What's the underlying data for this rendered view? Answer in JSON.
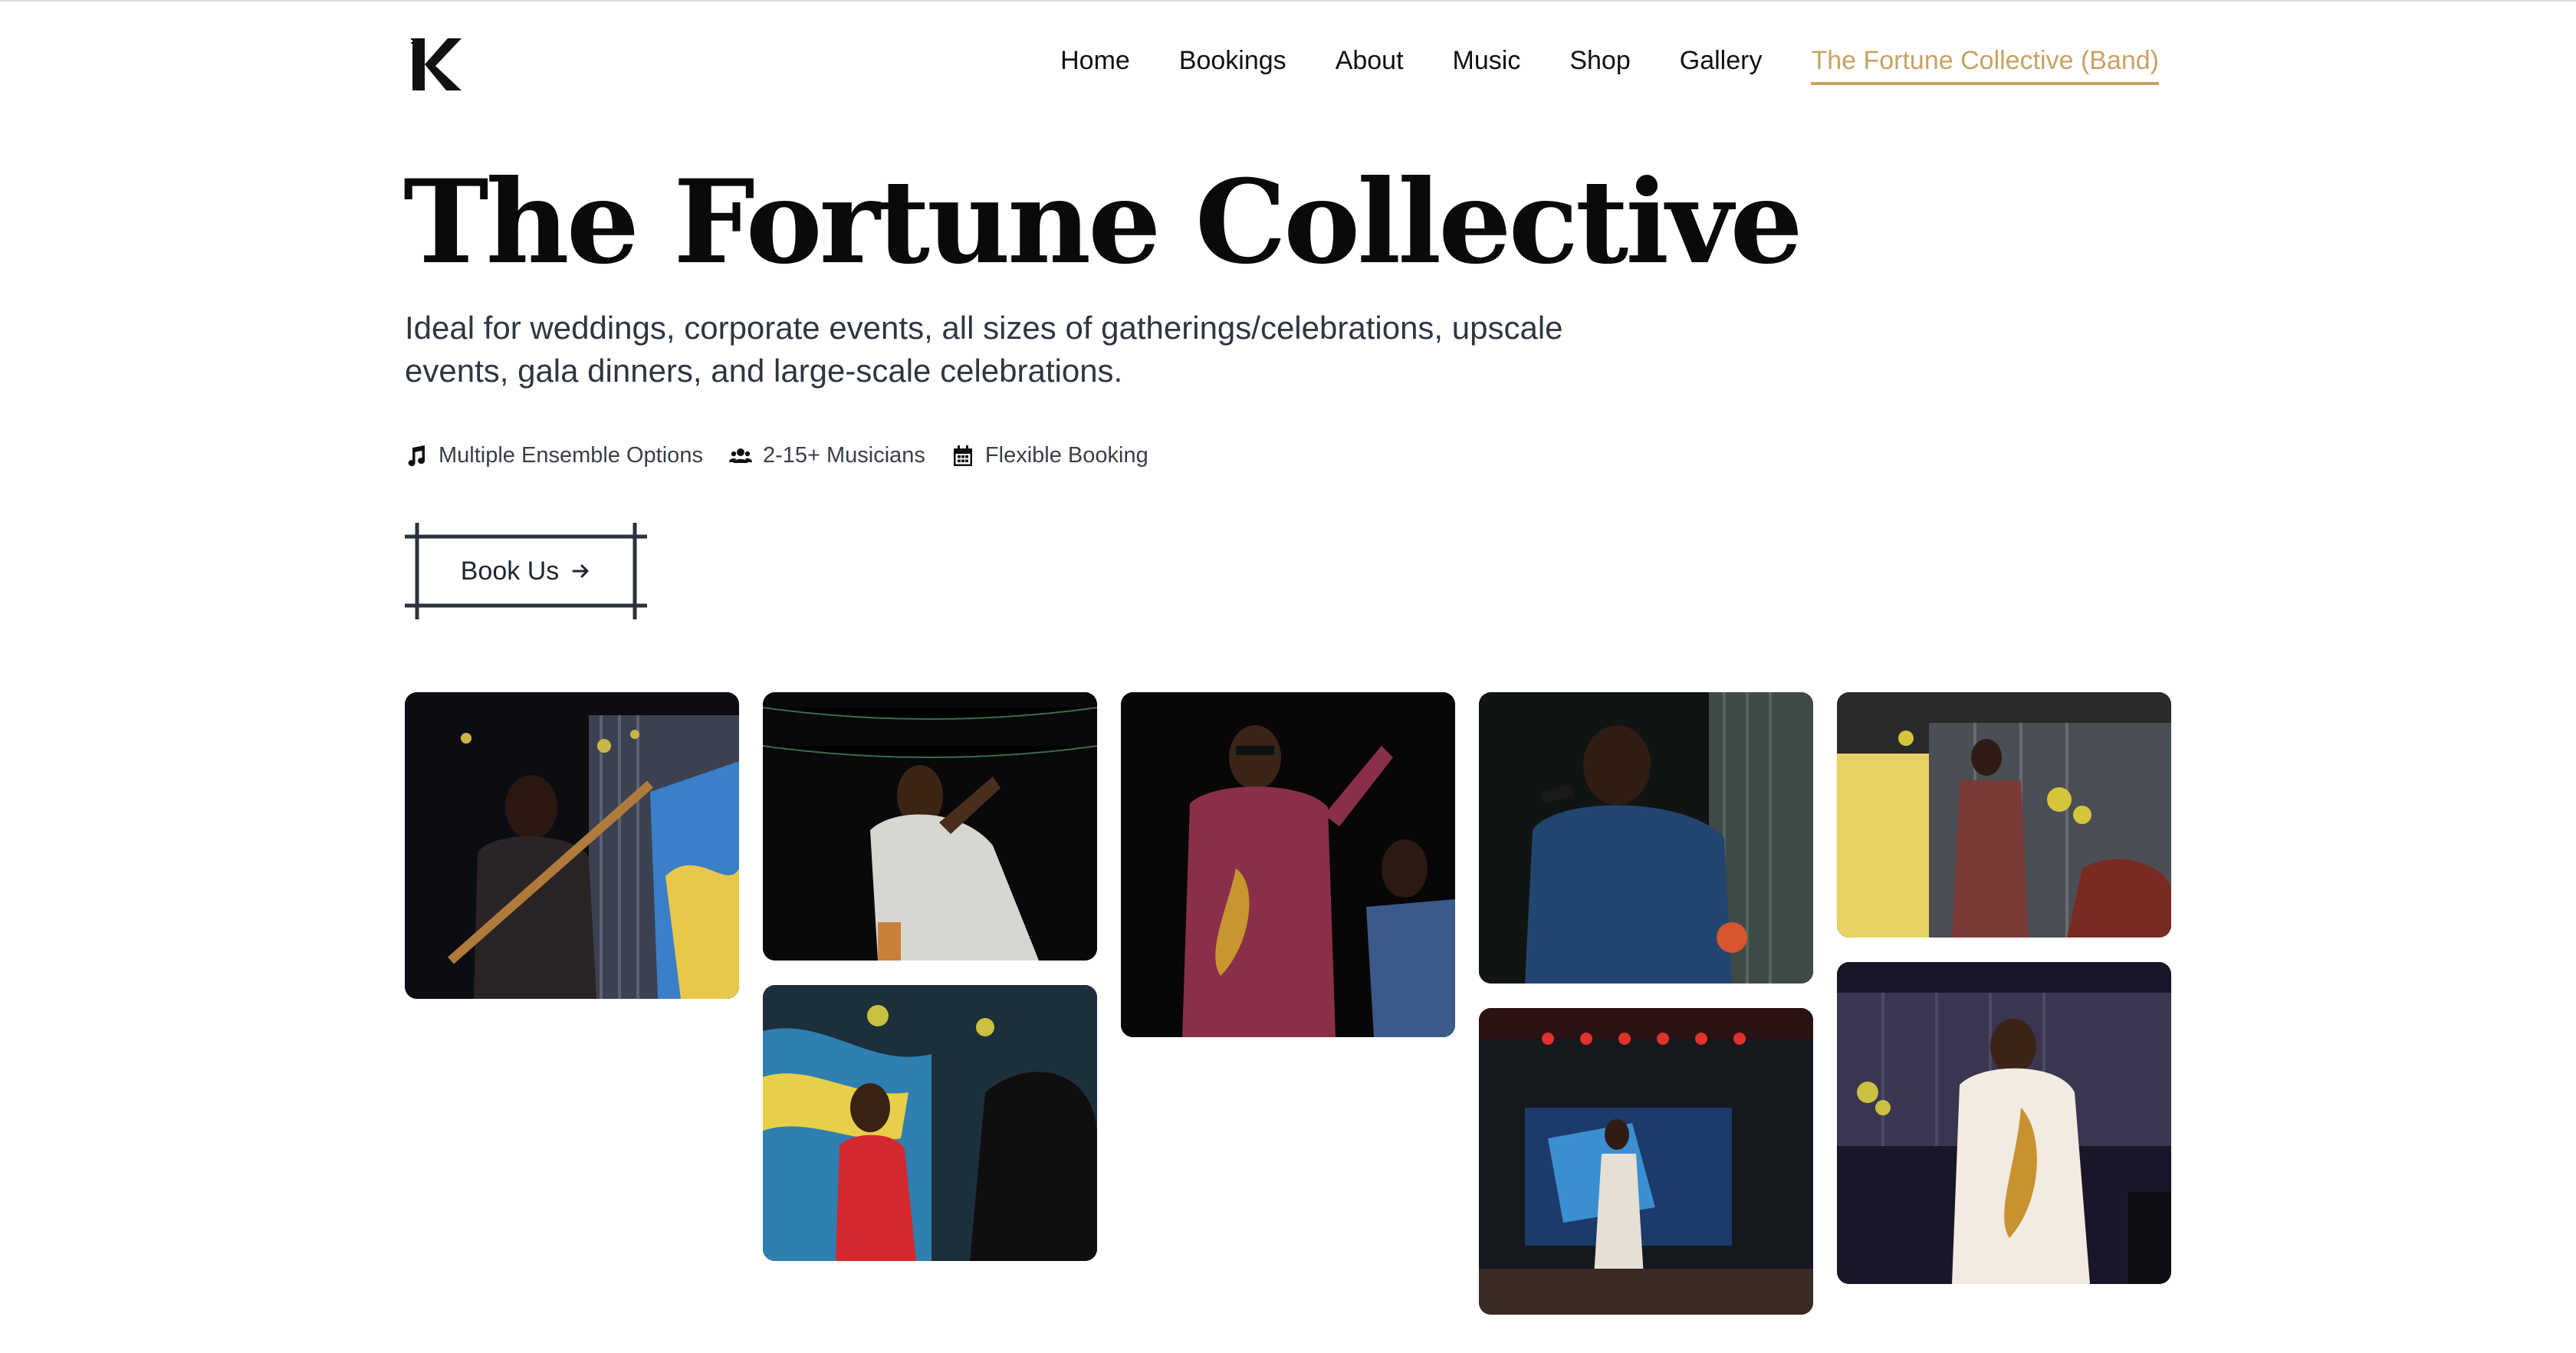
{
  "brand": {
    "logo_icon": "k-logo"
  },
  "nav": {
    "items": [
      {
        "label": "Home",
        "active": false
      },
      {
        "label": "Bookings",
        "active": false
      },
      {
        "label": "About",
        "active": false
      },
      {
        "label": "Music",
        "active": false
      },
      {
        "label": "Shop",
        "active": false
      },
      {
        "label": "Gallery",
        "active": false
      },
      {
        "label": "The Fortune Collective (Band)",
        "active": true
      }
    ],
    "accent": "#c8a264"
  },
  "hero": {
    "title": "The Fortune Collective",
    "subtitle": "Ideal for weddings, corporate events, all sizes of gatherings/celebrations, upscale events, gala dinners, and large-scale celebrations.",
    "features": [
      {
        "icon": "music-note-icon",
        "label": "Multiple Ensemble Options"
      },
      {
        "icon": "users-icon",
        "label": "2-15+ Musicians"
      },
      {
        "icon": "calendar-icon",
        "label": "Flexible Booking"
      }
    ],
    "cta": {
      "label": "Book Us",
      "icon": "arrow-right-icon"
    }
  },
  "gallery": {
    "photos": [
      {
        "subject": "bass guitarist"
      },
      {
        "subject": "vocalist in white"
      },
      {
        "subject": "saxophonist singing"
      },
      {
        "subject": "vocalist in blue"
      },
      {
        "subject": "band on stage"
      },
      {
        "subject": "singer in red dress"
      },
      {
        "subject": "performer on stage"
      },
      {
        "subject": "saxophonist in white"
      }
    ]
  }
}
